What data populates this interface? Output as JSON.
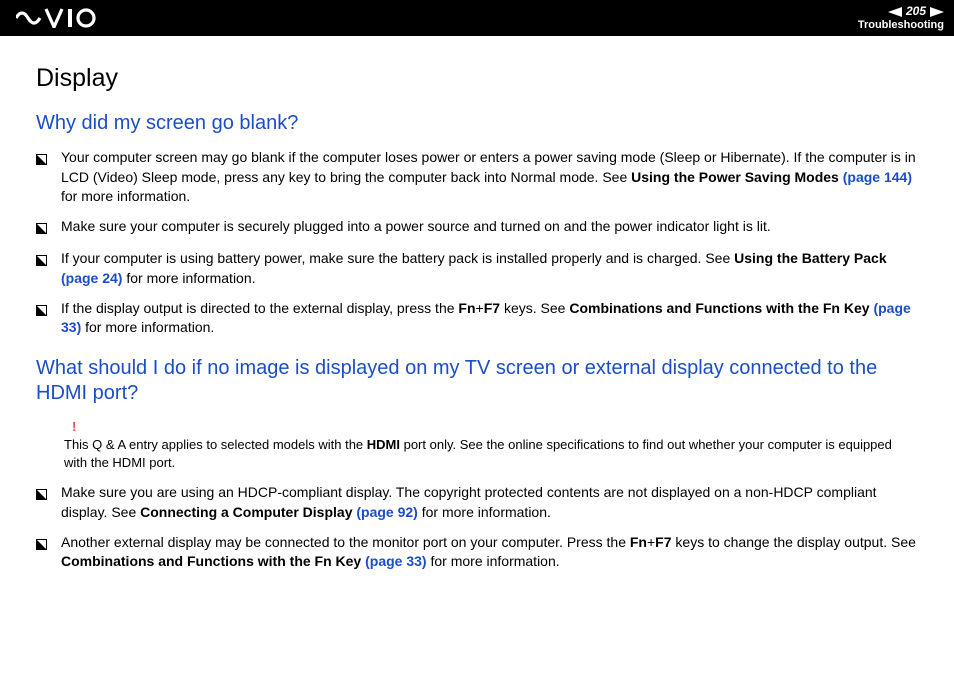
{
  "header": {
    "pageNumber": "205",
    "section": "Troubleshooting"
  },
  "title": "Display",
  "q1": {
    "heading": "Why did my screen go blank?",
    "items": [
      {
        "pre": "Your computer screen may go blank if the computer loses power or enters a power saving mode (Sleep or Hibernate). If the computer is in LCD (Video) Sleep mode, press any key to bring the computer back into Normal mode. See ",
        "bold1": "Using the Power Saving Modes",
        "link": " (page 144)",
        "post": " for more information."
      },
      {
        "pre": "Make sure your computer is securely plugged into a power source and turned on and the power indicator light is lit."
      },
      {
        "pre": "If your computer is using battery power, make sure the battery pack is installed properly and is charged. See ",
        "bold1": "Using the Battery Pack",
        "link": " (page 24)",
        "post": " for more information."
      },
      {
        "pre": "If the display output is directed to the external display, press the ",
        "bold1": "Fn",
        "mid1": "+",
        "bold2": "F7",
        "mid2": " keys. See ",
        "bold3": "Combinations and Functions with the Fn Key",
        "link": " (page 33)",
        "post": " for more information."
      }
    ]
  },
  "q2": {
    "heading": "What should I do if no image is displayed on my TV screen or external display connected to the HDMI port?",
    "noteMark": "!",
    "notePre": "This Q & A entry applies to selected models with the ",
    "noteBold": "HDMI",
    "notePost": " port only. See the online specifications to find out whether your computer is equipped with the HDMI port.",
    "items": [
      {
        "pre": "Make sure you are using an HDCP-compliant display. The copyright protected contents are not displayed on a non-HDCP compliant display. See ",
        "bold1": "Connecting a Computer Display",
        "link": " (page 92)",
        "post": " for more information."
      },
      {
        "pre": "Another external display may be connected to the monitor port on your computer. Press the ",
        "bold1": "Fn",
        "mid1": "+",
        "bold2": "F7",
        "mid2": " keys to change the display output. See ",
        "bold3": "Combinations and Functions with the Fn Key",
        "link": " (page 33)",
        "post": " for more information."
      }
    ]
  }
}
